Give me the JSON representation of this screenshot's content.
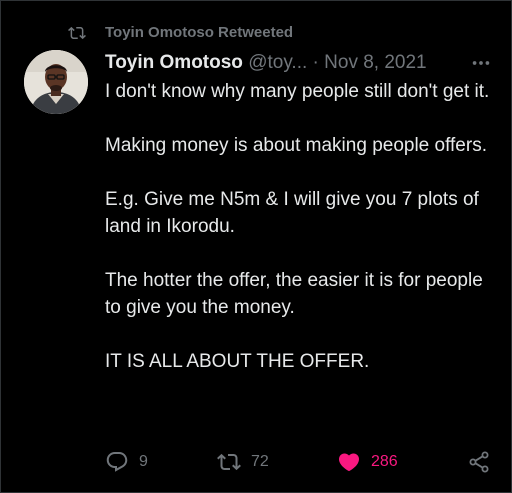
{
  "social_context": {
    "text": "Toyin Omotoso Retweeted",
    "icon": "retweet-icon"
  },
  "author": {
    "display_name": "Toyin Omotoso",
    "handle": "@toy...",
    "separator": "·",
    "date": "Nov 8, 2021",
    "avatar": "profile-photo"
  },
  "tweet": {
    "paragraphs": [
      "I don't know why many people still don't get it.",
      "Making money is about making people offers.",
      "E.g. Give me N5m & I will give you 7 plots of land in Ikorodu.",
      "The hotter the offer, the easier it is for people to give you the money.",
      "IT IS ALL ABOUT THE OFFER."
    ]
  },
  "actions": {
    "reply_count": "9",
    "retweet_count": "72",
    "like_count": "286",
    "liked": true
  },
  "colors": {
    "background": "#000000",
    "text_primary": "#e7e9ea",
    "text_secondary": "#71767b",
    "like_active": "#f91880"
  }
}
